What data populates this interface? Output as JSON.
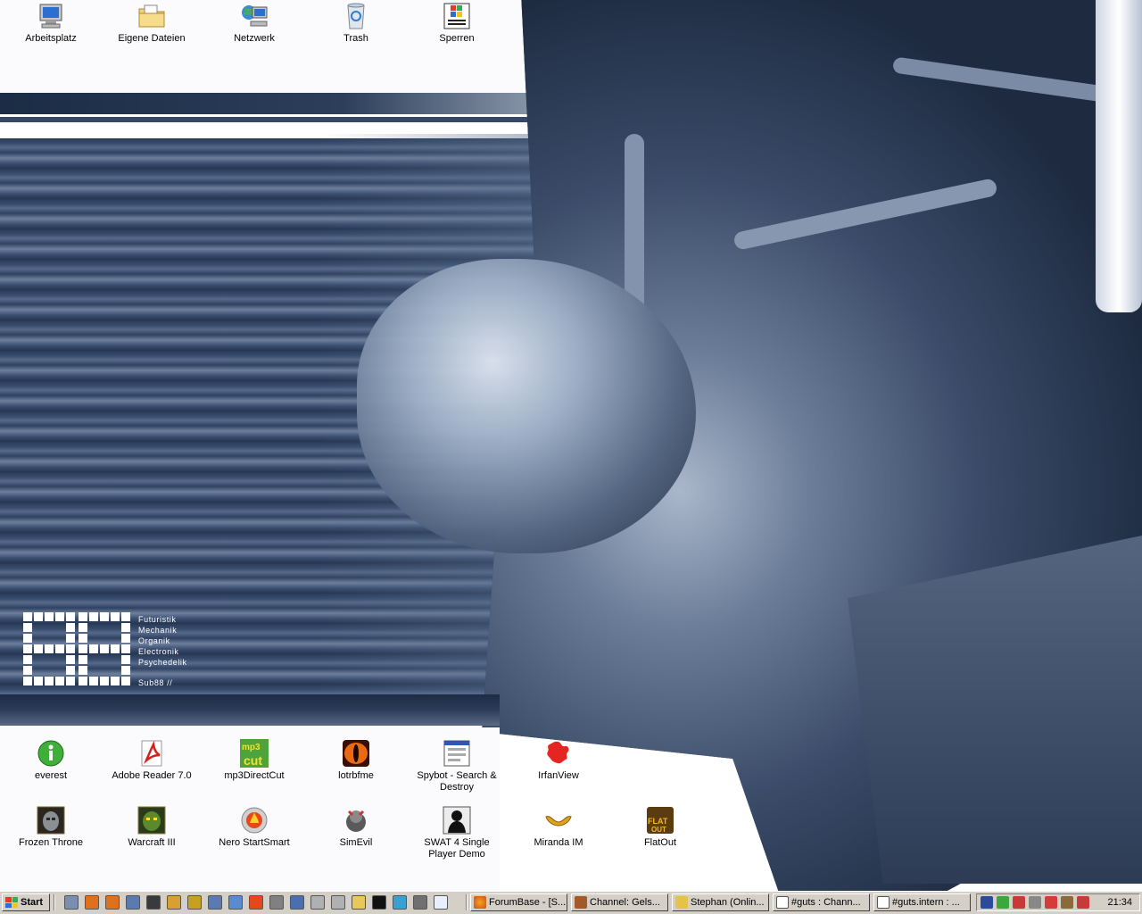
{
  "desktop": {
    "top_row": [
      {
        "label": "Arbeitsplatz",
        "icon": "computer-icon"
      },
      {
        "label": "Eigene Dateien",
        "icon": "folder-icon"
      },
      {
        "label": "Netzwerk",
        "icon": "network-icon"
      },
      {
        "label": "Trash",
        "icon": "recycle-bin-icon"
      },
      {
        "label": "Sperren",
        "icon": "windows-logo-icon"
      }
    ],
    "middle_row": [
      {
        "label": "everest",
        "icon": "info-icon"
      },
      {
        "label": "Adobe Reader 7.0",
        "icon": "adobe-reader-icon"
      },
      {
        "label": "mp3DirectCut",
        "icon": "mp3-cut-icon"
      },
      {
        "label": "lotrbfme",
        "icon": "eye-of-sauron-icon"
      },
      {
        "label": "Spybot - Search & Destroy",
        "icon": "spybot-icon"
      },
      {
        "label": "IrfanView",
        "icon": "irfanview-icon"
      }
    ],
    "bottom_row": [
      {
        "label": "Frozen Throne",
        "icon": "frozen-throne-icon"
      },
      {
        "label": "Warcraft III",
        "icon": "warcraft-icon"
      },
      {
        "label": "Nero StartSmart",
        "icon": "nero-icon"
      },
      {
        "label": "SimEvil",
        "icon": "simevil-icon"
      },
      {
        "label": "SWAT 4 Single Player Demo",
        "icon": "swat4-icon"
      },
      {
        "label": "Miranda IM",
        "icon": "miranda-icon"
      },
      {
        "label": "FlatOut",
        "icon": "flatout-icon"
      }
    ]
  },
  "wallpaper": {
    "logo_number": "88",
    "words": [
      "Futuristik",
      "Mechanik",
      "Organik",
      "Electronik",
      "Psychedelik"
    ],
    "signature": "Sub88 //"
  },
  "taskbar": {
    "start_label": "Start",
    "quick_launch": [
      "show-desktop-icon",
      "firefox-icon",
      "firefox-icon",
      "window-icon",
      "book-icon",
      "pencil-icon",
      "glasses-icon",
      "window-icon",
      "app-icon",
      "nero-icon",
      "tool-icon",
      "monitor-icon",
      "drive-icon",
      "drive-icon",
      "folder-icon",
      "cmd-icon",
      "paint-icon",
      "calculator-icon",
      "notepad-icon"
    ],
    "tasks": [
      {
        "label": "ForumBase - [S...",
        "icon": "firefox-icon"
      },
      {
        "label": "Channel: Gels...",
        "icon": "cup-icon"
      },
      {
        "label": "Stephan (Onlin...",
        "icon": "chat-icon"
      },
      {
        "label": "#guts : Chann...",
        "icon": "home-icon"
      },
      {
        "label": "#guts.intern : ...",
        "icon": "home-icon"
      }
    ],
    "tray_icons": [
      "shield-icon",
      "chat-icon",
      "user-icon",
      "calendar-icon",
      "calendar-icon",
      "pencil-icon",
      "chart-icon"
    ],
    "clock": "21:34"
  },
  "colors": {
    "taskbar": "#d4d0c8",
    "wallpaper_blue": "#2e405e"
  }
}
